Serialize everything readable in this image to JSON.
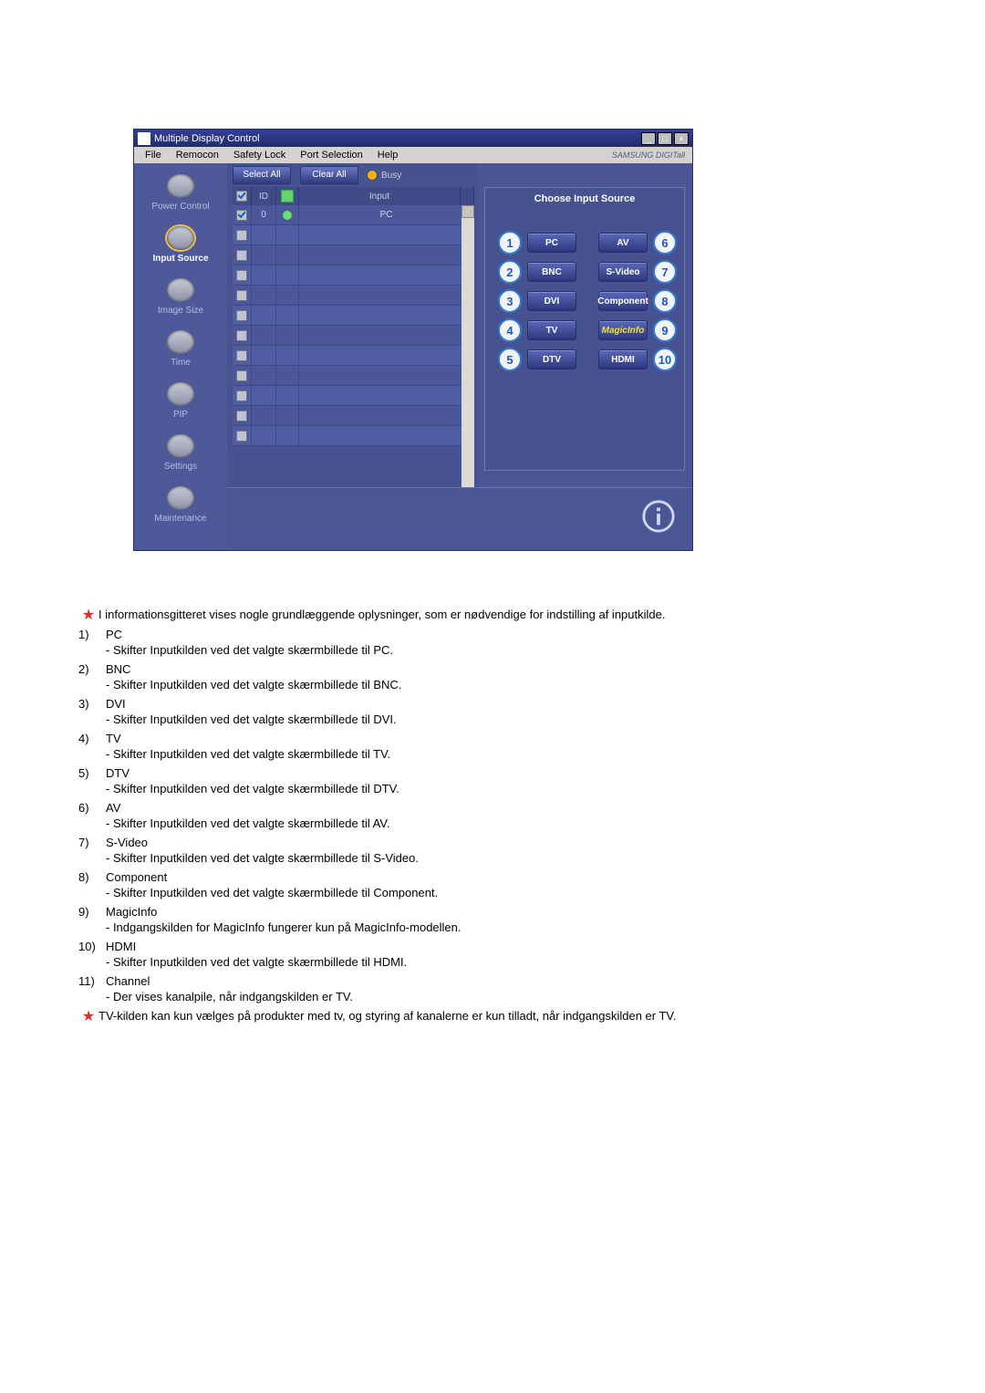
{
  "window": {
    "title": "Multiple Display Control",
    "menu": [
      "File",
      "Remocon",
      "Safety Lock",
      "Port Selection",
      "Help"
    ],
    "brand": "SAMSUNG DIGITall"
  },
  "sidebar": {
    "items": [
      {
        "label": "Power Control"
      },
      {
        "label": "Input Source"
      },
      {
        "label": "Image Size"
      },
      {
        "label": "Time"
      },
      {
        "label": "PIP"
      },
      {
        "label": "Settings"
      },
      {
        "label": "Maintenance"
      }
    ],
    "active_index": 1
  },
  "toolbar": {
    "select_all": "Select All",
    "clear_all": "Clear All",
    "busy": "Busy"
  },
  "grid": {
    "headers": {
      "id": "ID",
      "input": "Input"
    },
    "rows": [
      {
        "checked": true,
        "id": "0",
        "status": "ok",
        "input": "PC"
      },
      {
        "checked": false,
        "id": "",
        "status": "",
        "input": ""
      },
      {
        "checked": false,
        "id": "",
        "status": "",
        "input": ""
      },
      {
        "checked": false,
        "id": "",
        "status": "",
        "input": ""
      },
      {
        "checked": false,
        "id": "",
        "status": "",
        "input": ""
      },
      {
        "checked": false,
        "id": "",
        "status": "",
        "input": ""
      },
      {
        "checked": false,
        "id": "",
        "status": "",
        "input": ""
      },
      {
        "checked": false,
        "id": "",
        "status": "",
        "input": ""
      },
      {
        "checked": false,
        "id": "",
        "status": "",
        "input": ""
      },
      {
        "checked": false,
        "id": "",
        "status": "",
        "input": ""
      },
      {
        "checked": false,
        "id": "",
        "status": "",
        "input": ""
      },
      {
        "checked": false,
        "id": "",
        "status": "",
        "input": ""
      }
    ]
  },
  "panel": {
    "title": "Choose Input Source",
    "left": [
      {
        "n": "1",
        "l": "PC"
      },
      {
        "n": "2",
        "l": "BNC"
      },
      {
        "n": "3",
        "l": "DVI"
      },
      {
        "n": "4",
        "l": "TV"
      },
      {
        "n": "5",
        "l": "DTV"
      }
    ],
    "right": [
      {
        "n": "6",
        "l": "AV"
      },
      {
        "n": "7",
        "l": "S-Video"
      },
      {
        "n": "8",
        "l": "Component"
      },
      {
        "n": "9",
        "l": "MagicInfo"
      },
      {
        "n": "10",
        "l": "HDMI"
      }
    ]
  },
  "doc": {
    "intro": "I informationsgitteret vises nogle grundlæggende oplysninger, som er nødvendige for indstilling af inputkilde.",
    "items": [
      {
        "num": "1)",
        "name": "PC",
        "desc": "- Skifter Inputkilden ved det valgte skærmbillede til PC."
      },
      {
        "num": "2)",
        "name": "BNC",
        "desc": "- Skifter Inputkilden ved det valgte skærmbillede til BNC."
      },
      {
        "num": "3)",
        "name": "DVI",
        "desc": "- Skifter Inputkilden ved det valgte skærmbillede til DVI."
      },
      {
        "num": "4)",
        "name": "TV",
        "desc": "- Skifter Inputkilden ved det valgte skærmbillede til TV."
      },
      {
        "num": "5)",
        "name": "DTV",
        "desc": "- Skifter Inputkilden ved det valgte skærmbillede til DTV."
      },
      {
        "num": "6)",
        "name": "AV",
        "desc": "- Skifter Inputkilden ved det valgte skærmbillede til AV."
      },
      {
        "num": "7)",
        "name": "S-Video",
        "desc": "- Skifter Inputkilden ved det valgte skærmbillede til S-Video."
      },
      {
        "num": "8)",
        "name": "Component",
        "desc": "- Skifter Inputkilden ved det valgte skærmbillede til Component."
      },
      {
        "num": "9)",
        "name": "MagicInfo",
        "desc": "- Indgangskilden for MagicInfo fungerer kun på MagicInfo-modellen."
      },
      {
        "num": "10)",
        "name": "HDMI",
        "desc": "- Skifter Inputkilden ved det valgte skærmbillede til HDMI."
      },
      {
        "num": "11)",
        "name": "Channel",
        "desc": "- Der vises kanalpile, når indgangskilden er TV."
      }
    ],
    "footnote": "TV-kilden kan kun vælges på produkter med tv, og styring af kanalerne er kun tilladt, når indgangskilden er TV."
  }
}
